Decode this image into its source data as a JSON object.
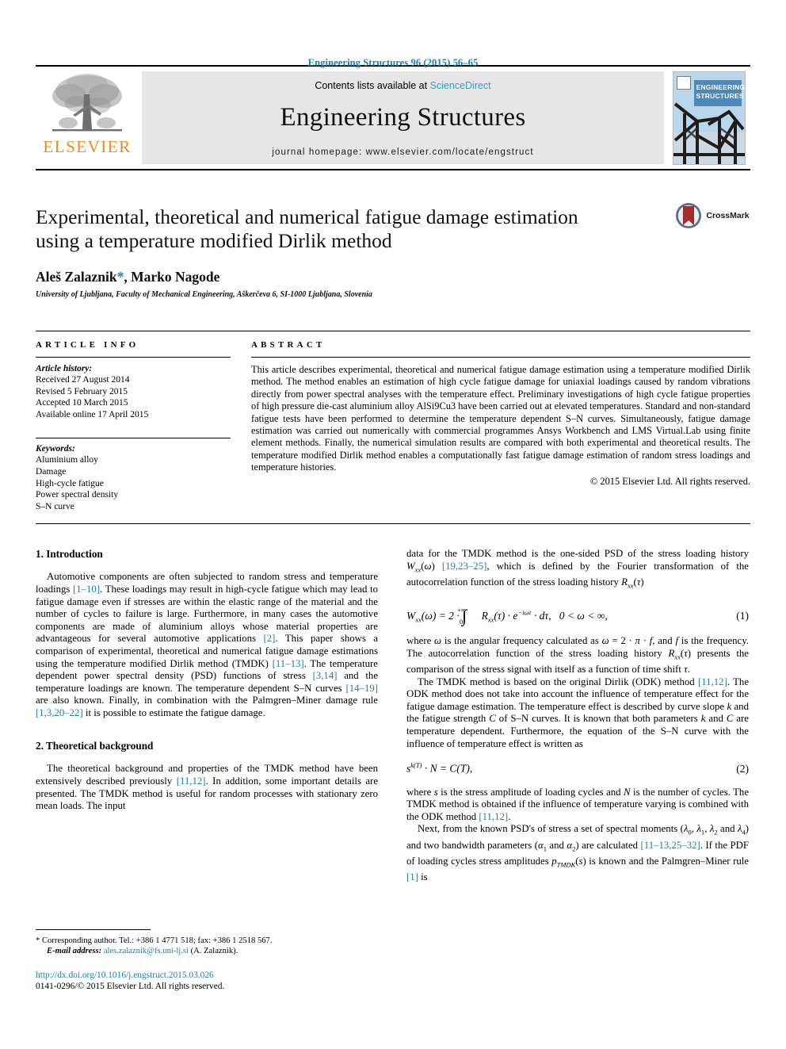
{
  "running_head": "Engineering Structures 96 (2015) 56–65",
  "masthead": {
    "publisher_name": "ELSEVIER",
    "contents_prefix": "Contents lists available at ",
    "contents_link": "ScienceDirect",
    "journal_name": "Engineering Structures",
    "homepage": "journal homepage: www.elsevier.com/locate/engstruct",
    "cover_title_line1": "ENGINEERING",
    "cover_title_line2": "STRUCTURES"
  },
  "article": {
    "title_line1": "Experimental, theoretical and numerical fatigue damage estimation",
    "title_line2": "using a temperature modified Dirlik method",
    "authors": "Aleš Zalaznik",
    "author_marker": "*",
    "authors_rest": ", Marko Nagode",
    "affiliation": "University of Ljubljana, Faculty of Mechanical Engineering, Aškerčeva 6, SI-1000 Ljubljana, Slovenia",
    "crossmark_label": "CrossMark"
  },
  "info": {
    "heading": "ARTICLE INFO",
    "history_label": "Article history:",
    "history": [
      "Received 27 August 2014",
      "Revised 5 February 2015",
      "Accepted 10 March 2015",
      "Available online 17 April 2015"
    ],
    "keywords_label": "Keywords:",
    "keywords": [
      "Aluminium alloy",
      "Damage",
      "High-cycle fatigue",
      "Power spectral density",
      "S–N curve"
    ]
  },
  "abstract": {
    "heading": "ABSTRACT",
    "text": "This article describes experimental, theoretical and numerical fatigue damage estimation using a temperature modified Dirlik method. The method enables an estimation of high cycle fatigue damage for uniaxial loadings caused by random vibrations directly from power spectral analyses with the temperature effect. Preliminary investigations of high cycle fatigue properties of high pressure die-cast aluminium alloy AlSi9Cu3 have been carried out at elevated temperatures. Standard and non-standard fatigue tests have been performed to determine the temperature dependent S–N curves. Simultaneously, fatigue damage estimation was carried out numerically with commercial programmes Ansys Workbench and LMS Virtual.Lab using finite element methods. Finally, the numerical simulation results are compared with both experimental and theoretical results. The temperature modified Dirlik method enables a computationally fast fatigue damage estimation of random stress loadings and temperature histories.",
    "copyright": "© 2015 Elsevier Ltd. All rights reserved."
  },
  "sections": {
    "intro_heading": "1. Introduction",
    "intro_p1": "Automotive components are often subjected to random stress and temperature loadings [1–10]. These loadings may result in high-cycle fatigue which may lead to fatigue damage even if stresses are within the elastic range of the material and the number of cycles to failure is large. Furthermore, in many cases the automotive components are made of aluminium alloys whose material properties are advantageous for several automotive applications [2]. This paper shows a comparison of experimental, theoretical and numerical fatigue damage estimations using the temperature modified Dirlik method (TMDK) [11–13]. The temperature dependent power spectral density (PSD) functions of stress [3,14] and the temperature loadings are known. The temperature dependent S–N curves [14–19] are also known. Finally, in combination with the Palmgren–Miner damage rule [1,3,20–22] it is possible to estimate the fatigue damage.",
    "theory_heading": "2. Theoretical background",
    "theory_p1": "The theoretical background and properties of the TMDK method have been extensively described previously [11,12]. In addition, some important details are presented. The TMDK method is useful for random processes with stationary zero mean loads. The input",
    "right_p1": "data for the TMDK method is the one-sided PSD of the stress loading history Wxx(ω) [19,23–25], which is defined by the Fourier transformation of the autocorrelation function of the stress loading history Rxx(τ)",
    "right_p2": "where ω is the angular frequency calculated as ω = 2 · π · f, and f is the frequency. The autocorrelation function of the stress loading history Rxx(τ) presents the comparison of the stress signal with itself as a function of time shift τ.",
    "right_p3": "The TMDK method is based on the original Dirlik (ODK) method [11,12]. The ODK method does not take into account the influence of temperature effect for the fatigue damage estimation. The temperature effect is described by curve slope k and the fatigue strength C of S–N curves. It is known that both parameters k and C are temperature dependent. Furthermore, the equation of the S–N curve with the influence of temperature effect is written as",
    "right_p4": "where s is the stress amplitude of loading cycles and N is the number of cycles. The TMDK method is obtained if the influence of temperature varying is combined with the ODK method [11,12].",
    "right_p5": "Next, from the known PSD's of stress a set of spectral moments (λ0, λ1, λ2 and λ4) and two bandwidth parameters (α1 and α2) are calculated [11–13,25–32]. If the PDF of loading cycles stress amplitudes pTMDK(s) is known and the Palmgren–Miner rule [1] is"
  },
  "equations": {
    "eq1_number": "(1)",
    "eq2_number": "(2)",
    "eq1_text": "Wxx(ω) = 2 · ∫0+∞ Rxx(τ) · e−iωτ · dτ,  0 < ω < ∞,",
    "eq2_text": "sk(T) · N = C(T),"
  },
  "footnote": {
    "corresponding": "* Corresponding author. Tel.: +386 1 4771 518; fax: +386 1 2518 567.",
    "email_label": "E-mail address:",
    "email": "ales.zalaznik@fs.uni-lj.si",
    "email_suffix": " (A. Zalaznik).",
    "doi": "http://dx.doi.org/10.1016/j.engstruct.2015.03.026",
    "issn": "0141-0296/© 2015 Elsevier Ltd. All rights reserved."
  },
  "colors": {
    "link_blue": "#1a7eb0",
    "sciencedirect_blue": "#2a9fd6",
    "elsevier_orange": "#f08a1c",
    "crossmark_red": "#a32c2c"
  }
}
